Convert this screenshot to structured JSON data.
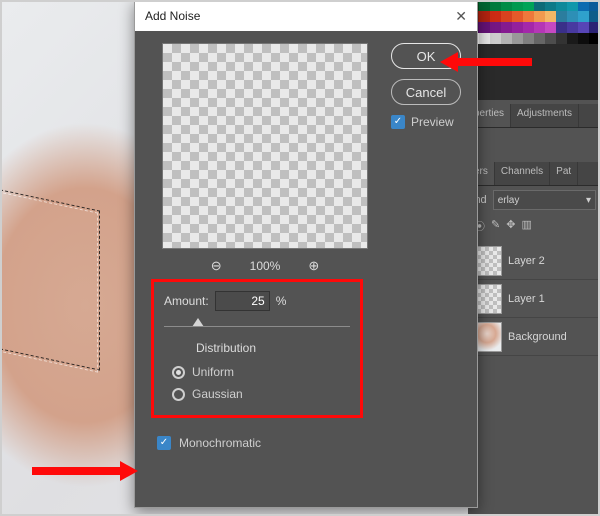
{
  "dialog": {
    "title": "Add Noise",
    "ok_label": "OK",
    "cancel_label": "Cancel",
    "preview_label": "Preview",
    "zoom_pct": "100%",
    "amount_label": "Amount:",
    "amount_value": "25",
    "amount_unit": "%",
    "distribution_label": "Distribution",
    "uniform_label": "Uniform",
    "gaussian_label": "Gaussian",
    "monochromatic_label": "Monochromatic"
  },
  "panels": {
    "tabs1": {
      "properties": "perties",
      "adjustments": "Adjustments"
    },
    "tabs2": {
      "layers": "ers",
      "channels": "Channels",
      "paths": "Pat"
    },
    "kind_label": "ind",
    "blend_mode": "erlay",
    "layers": [
      {
        "name": "Layer 2"
      },
      {
        "name": "Layer 1"
      },
      {
        "name": "Background"
      }
    ]
  },
  "swatch_colors": [
    "#004d1a",
    "#006633",
    "#007a3d",
    "#008b46",
    "#00994f",
    "#00a357",
    "#0d6b77",
    "#0e7a88",
    "#0f899a",
    "#1197ab",
    "#0b6bb0",
    "#0a5c99",
    "#9a1b0b",
    "#b32310",
    "#cc2b14",
    "#d8421f",
    "#e55a2a",
    "#ee783c",
    "#f19a4f",
    "#f4b766",
    "#2b7d9e",
    "#2d8fb6",
    "#2fa1cc",
    "#0d5e8a",
    "#520e68",
    "#651276",
    "#751683",
    "#851a90",
    "#94209d",
    "#a428aa",
    "#b536b6",
    "#c649c2",
    "#3a2f89",
    "#4839a0",
    "#5745b6",
    "#2a2374",
    "#ffffff",
    "#e6e6e6",
    "#cccccc",
    "#b3b3b3",
    "#999999",
    "#808080",
    "#666666",
    "#4d4d4d",
    "#333333",
    "#1a1a1a",
    "#0d0d0d",
    "#000000"
  ]
}
